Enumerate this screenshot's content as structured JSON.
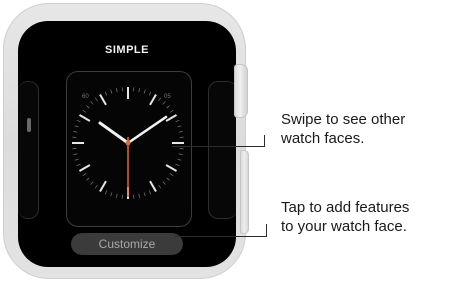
{
  "watch": {
    "face_name": "SIMPLE",
    "customize_label": "Customize"
  },
  "callouts": {
    "swipe": {
      "line1": "Swipe to see other",
      "line2": "watch faces."
    },
    "tap": {
      "line1": "Tap to add features",
      "line2": "to your watch face."
    }
  },
  "colors": {
    "accent_hand": "#e8672a",
    "screen": "#000000",
    "case": "#e0e0e0"
  }
}
